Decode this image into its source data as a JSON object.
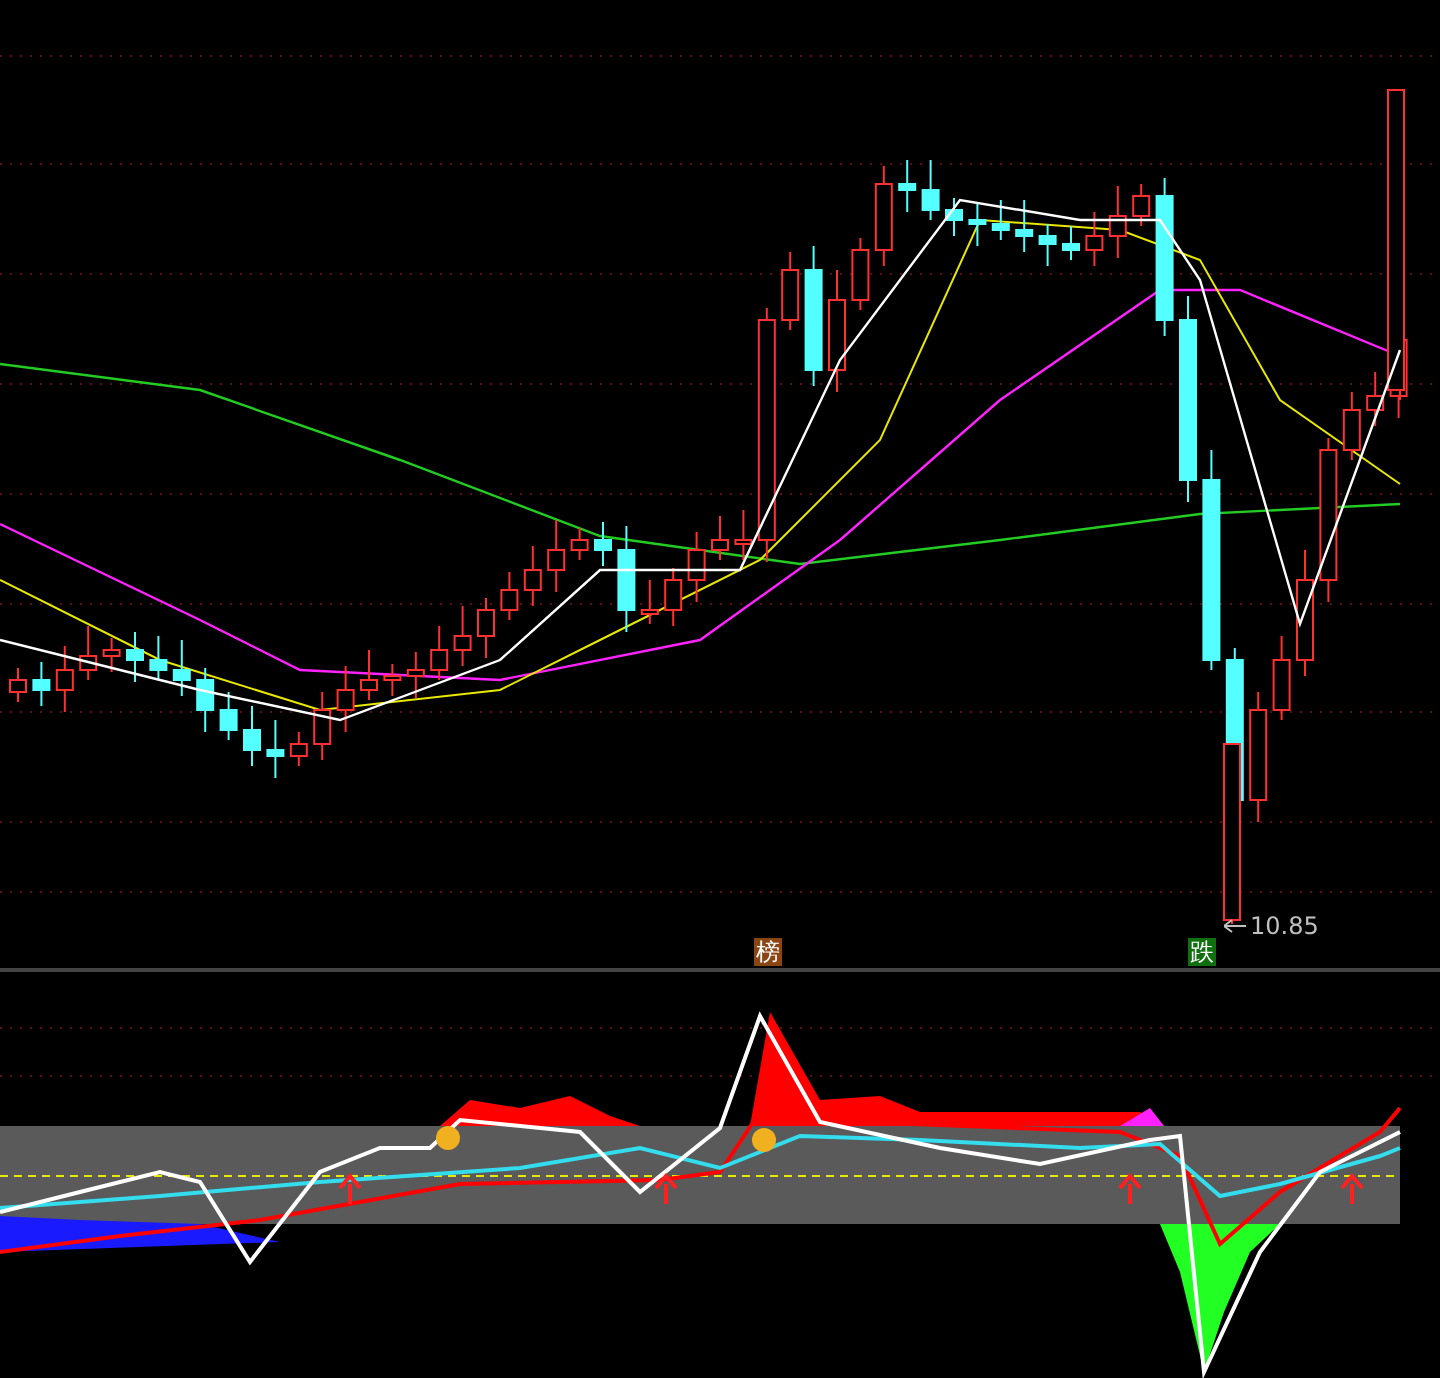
{
  "price_panel": {
    "low_label": "10.85"
  },
  "markers": [
    {
      "text": "榜",
      "color": "#8b4513"
    },
    {
      "text": "跌",
      "color": "#107010"
    }
  ]
}
